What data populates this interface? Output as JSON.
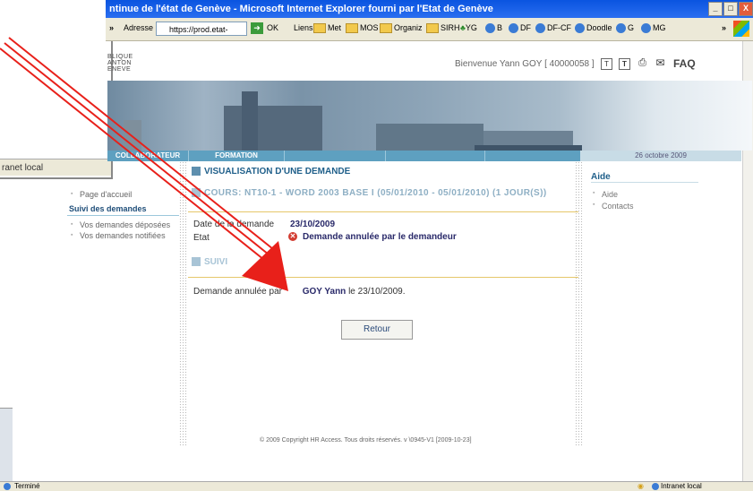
{
  "window": {
    "title": "ntinue de l'état de Genève - Microsoft Internet Explorer fourni par l'Etat de Genève",
    "buttons": [
      "_",
      "□",
      "X"
    ]
  },
  "toolbar": {
    "address_label": "Adresse",
    "address_value": "https://prod.etat-ge.ch/",
    "go_label": "OK",
    "links_label": "Liens",
    "links": [
      "Met",
      "MOS",
      "Organiz",
      "SIRH",
      "YG",
      "B",
      "DF",
      "DF-CF",
      "Doodle",
      "G",
      "MG"
    ]
  },
  "left_window": {
    "status": "ranet local"
  },
  "header": {
    "logo_lines": [
      "BLIQUE",
      "ANTON",
      "ENEVE"
    ],
    "welcome": "Bienvenue Yann GOY [ 40000058 ]",
    "faq": "FAQ",
    "icon_labels": [
      "T",
      "T"
    ]
  },
  "nav": {
    "tabs": [
      "COLLABORATEUR",
      "FORMATION",
      "",
      ""
    ],
    "date": "26 octobre 2009"
  },
  "sidebar": {
    "home": "Page d'accueil",
    "section": "Suivi des demandes",
    "items": [
      "Vos demandes déposées",
      "Vos demandes notifiées"
    ]
  },
  "main": {
    "title": "VISUALISATION D'UNE DEMANDE",
    "course": "COURS: NT10-1 - WORD 2003 BASE I (05/01/2010 - 05/01/2010) (1 JOUR(S))",
    "date_label": "Date de la demande",
    "date_value": "23/10/2009",
    "state_label": "Etat",
    "state_value": "Demande annulée par le demandeur",
    "suivi": "SUIVI",
    "cancel_text": "Demande annulée par",
    "cancel_by": "GOY Yann",
    "cancel_date": "le 23/10/2009.",
    "retour": "Retour",
    "copyright": "© 2009 Copyright HR Access. Tous droits réservés. v \\0945-V1 [2009-10-23]"
  },
  "aide": {
    "title": "Aide",
    "links": [
      "Aide",
      "Contacts"
    ]
  },
  "statusbar": {
    "left": "Terminé",
    "right": "Intranet local"
  },
  "colors": {
    "accent": "#1f5f8a",
    "arrow": "#e8201a"
  }
}
